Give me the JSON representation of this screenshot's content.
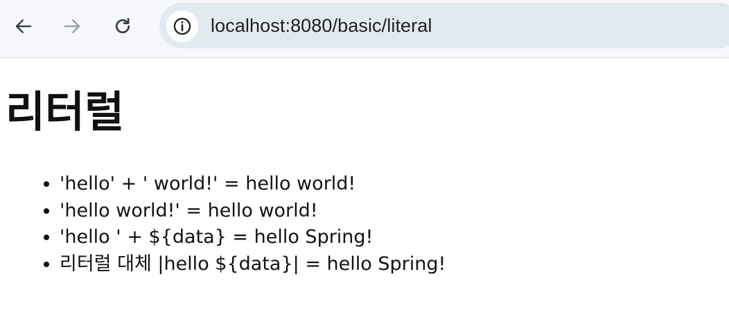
{
  "browser": {
    "url": "localhost:8080/basic/literal",
    "nav": {
      "back_icon": "arrow-left-icon",
      "forward_icon": "arrow-right-icon",
      "reload_icon": "reload-icon",
      "site_info_icon": "info-circle-icon"
    },
    "colors": {
      "toolbar_bg": "#f6f8fb",
      "omnibox_bg": "#e1eaef",
      "icon_active": "#3c4043",
      "icon_disabled": "#9aa0a6"
    }
  },
  "page": {
    "heading": "리터럴",
    "items": [
      "'hello' + ' world!' = hello world!",
      "'hello world!' = hello world!",
      "'hello ' + ${data} = hello Spring!",
      "리터럴 대체 |hello ${data}| = hello Spring!"
    ]
  }
}
